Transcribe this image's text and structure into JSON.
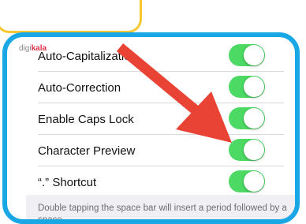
{
  "watermark": {
    "part1": "digi",
    "part2": "kala"
  },
  "settings": [
    {
      "label": "Auto-Capitalization",
      "on": true
    },
    {
      "label": "Auto-Correction",
      "on": true
    },
    {
      "label": "Enable Caps Lock",
      "on": true
    },
    {
      "label": "Character Preview",
      "on": true
    },
    {
      "label": "“.” Shortcut",
      "on": true
    }
  ],
  "footer_note": "Double tapping the space bar will insert a period followed by a space.",
  "colors": {
    "toggle_on": "#4cd964",
    "panel_border": "#1aa7e6",
    "yellow_outline": "#f7c72f",
    "arrow": "#e94335"
  }
}
